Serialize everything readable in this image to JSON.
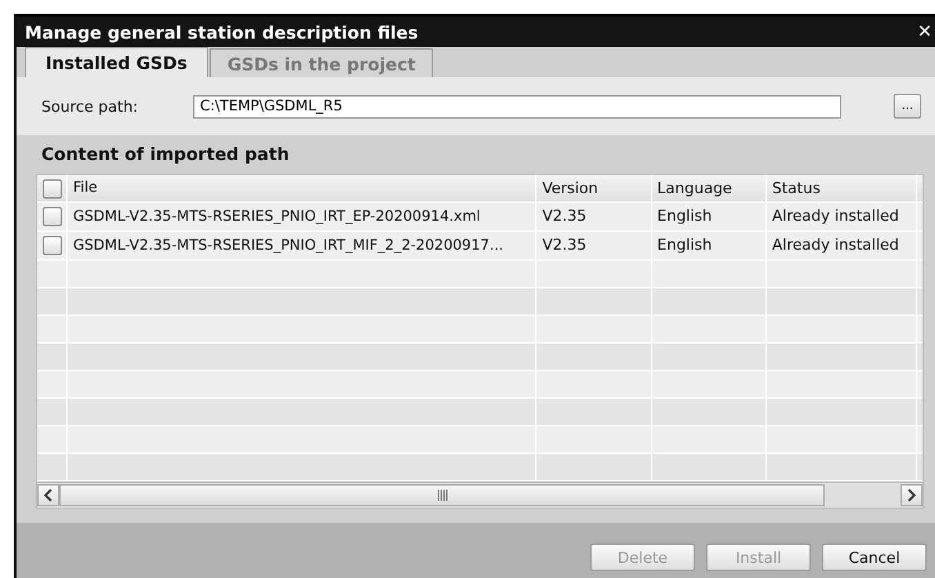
{
  "window": {
    "title": "Manage general station description files",
    "close": "✕"
  },
  "tabs": [
    {
      "label": "Installed GSDs",
      "selected": true
    },
    {
      "label": "GSDs in the project",
      "selected": false
    }
  ],
  "source_path": {
    "label": "Source path:",
    "value": "C:\\TEMP\\GSDML_R5",
    "browse": "..."
  },
  "section_title": "Content of imported path",
  "table": {
    "select_all_checked": false,
    "columns": [
      "File",
      "Version",
      "Language",
      "Status"
    ],
    "rows": [
      {
        "checked": false,
        "cells": [
          "GSDML-V2.35-MTS-RSERIES_PNIO_IRT_EP-20200914.xml",
          "V2.35",
          "English",
          "Already installed"
        ]
      },
      {
        "checked": false,
        "cells": [
          "GSDML-V2.35-MTS-RSERIES_PNIO_IRT_MIF_2_2-20200917...",
          "V2.35",
          "English",
          "Already installed"
        ]
      }
    ]
  },
  "buttons": [
    {
      "label": "Delete",
      "disabled": true
    },
    {
      "label": "Install",
      "disabled": true
    },
    {
      "label": "Cancel",
      "disabled": false
    }
  ]
}
